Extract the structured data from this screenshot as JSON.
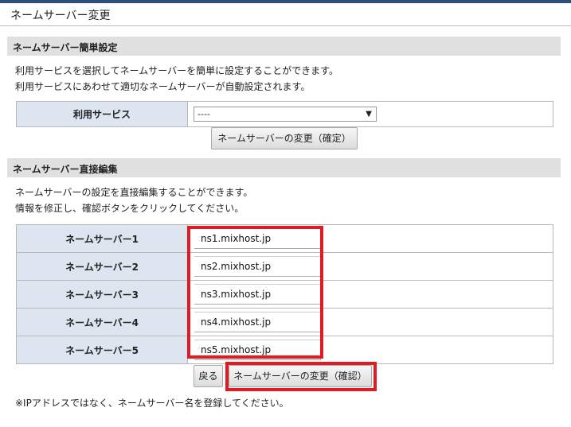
{
  "page": {
    "title": "ネームサーバー変更"
  },
  "simple": {
    "heading": "ネームサーバー簡単設定",
    "desc_line1": "利用サービスを選択してネームサーバーを簡単に設定することができます。",
    "desc_line2": "利用サービスにあわせて適切なネームサーバーが自動設定されます。",
    "service_label": "利用サービス",
    "service_selected": "----",
    "confirm_button": "ネームサーバーの変更（確定）"
  },
  "direct": {
    "heading": "ネームサーバー直接編集",
    "desc_line1": "ネームサーバーの設定を直接編集することができます。",
    "desc_line2": "情報を修正し、確認ボタンをクリックしてください。",
    "rows": [
      {
        "label": "ネームサーバー1",
        "value": "ns1.mixhost.jp"
      },
      {
        "label": "ネームサーバー2",
        "value": "ns2.mixhost.jp"
      },
      {
        "label": "ネームサーバー3",
        "value": "ns3.mixhost.jp"
      },
      {
        "label": "ネームサーバー4",
        "value": "ns4.mixhost.jp"
      },
      {
        "label": "ネームサーバー5",
        "value": "ns5.mixhost.jp"
      }
    ],
    "back_button": "戻る",
    "check_button": "ネームサーバーの変更（確認）"
  },
  "note": "※IPアドレスではなく、ネームサーバー名を登録してください。",
  "colors": {
    "highlight": "#e01b22",
    "label_bg": "#dde6f0",
    "section_bg": "#e0e0e0"
  }
}
